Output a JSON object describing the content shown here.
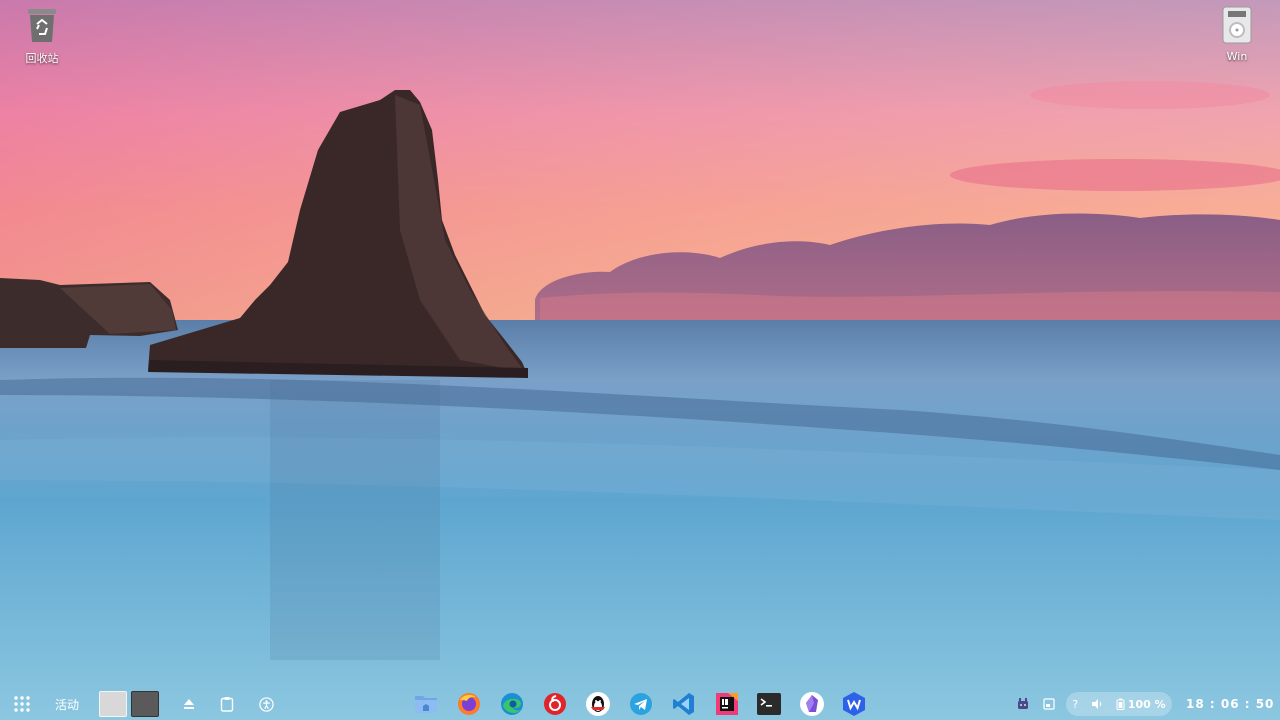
{
  "desktop": {
    "trash": {
      "label": "回收站",
      "icon": "recycle-bin-icon"
    },
    "drive": {
      "label": "Win",
      "icon": "drive-icon"
    }
  },
  "taskbar": {
    "activities_label": "活动",
    "left_icons": [
      "app-grid-icon",
      "eject-icon",
      "clipboard-icon",
      "accessibility-icon"
    ],
    "workspaces": [
      {
        "name": "workspace-1",
        "active": true,
        "color": "#d8d8d8"
      },
      {
        "name": "workspace-2",
        "active": false,
        "color": "#5a5a5a"
      }
    ],
    "apps": [
      "file-manager-icon",
      "firefox-icon",
      "edge-icon",
      "netease-music-icon",
      "qq-icon",
      "telegram-icon",
      "vscode-icon",
      "intellij-icon",
      "terminal-icon",
      "obsidian-icon",
      "wps-icon"
    ],
    "tray": {
      "help_glyph": "?",
      "battery_percent": "100 %"
    },
    "clock": "18 : 06 : 50"
  },
  "colors": {
    "sky_top": "#a87cc6",
    "sky_mid": "#f08aa0",
    "sky_low": "#f8b080",
    "sea": "#4fa4cc",
    "rock": "#3a2a2a"
  }
}
